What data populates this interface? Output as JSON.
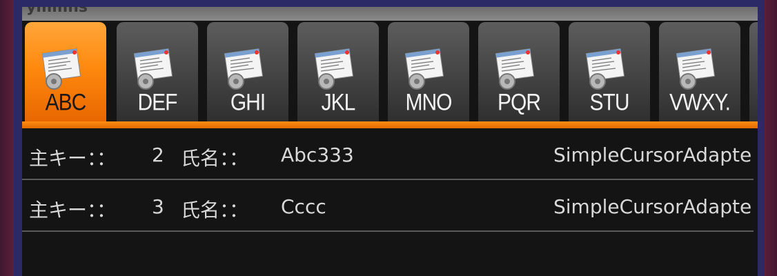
{
  "window": {
    "title_fragment": "ymmns"
  },
  "tabs": [
    {
      "label": "ABC",
      "icon": "document-gear-icon",
      "selected": true
    },
    {
      "label": "DEF",
      "icon": "document-gear-icon",
      "selected": false
    },
    {
      "label": "GHI",
      "icon": "document-gear-icon",
      "selected": false
    },
    {
      "label": "JKL",
      "icon": "document-gear-icon",
      "selected": false
    },
    {
      "label": "MNO",
      "icon": "document-gear-icon",
      "selected": false
    },
    {
      "label": "PQR",
      "icon": "document-gear-icon",
      "selected": false
    },
    {
      "label": "STU",
      "icon": "document-gear-icon",
      "selected": false
    },
    {
      "label": "VWXY.",
      "icon": "document-gear-icon",
      "selected": false
    }
  ],
  "list": {
    "rows": [
      {
        "key_label": "主キー：：",
        "key_value": "2",
        "name_label": "氏名：：",
        "name_value": "Abc333",
        "adapter": "SimpleCursorAdapte"
      },
      {
        "key_label": "主キー：：",
        "key_value": "3",
        "name_label": "氏名：：",
        "name_value": "Cccc",
        "adapter": "SimpleCursorAdapte"
      }
    ]
  },
  "colors": {
    "accent": "#ff8a0f",
    "tab_inactive": "#4a4a4a",
    "background": "#121212",
    "text": "#d8d8d8"
  }
}
